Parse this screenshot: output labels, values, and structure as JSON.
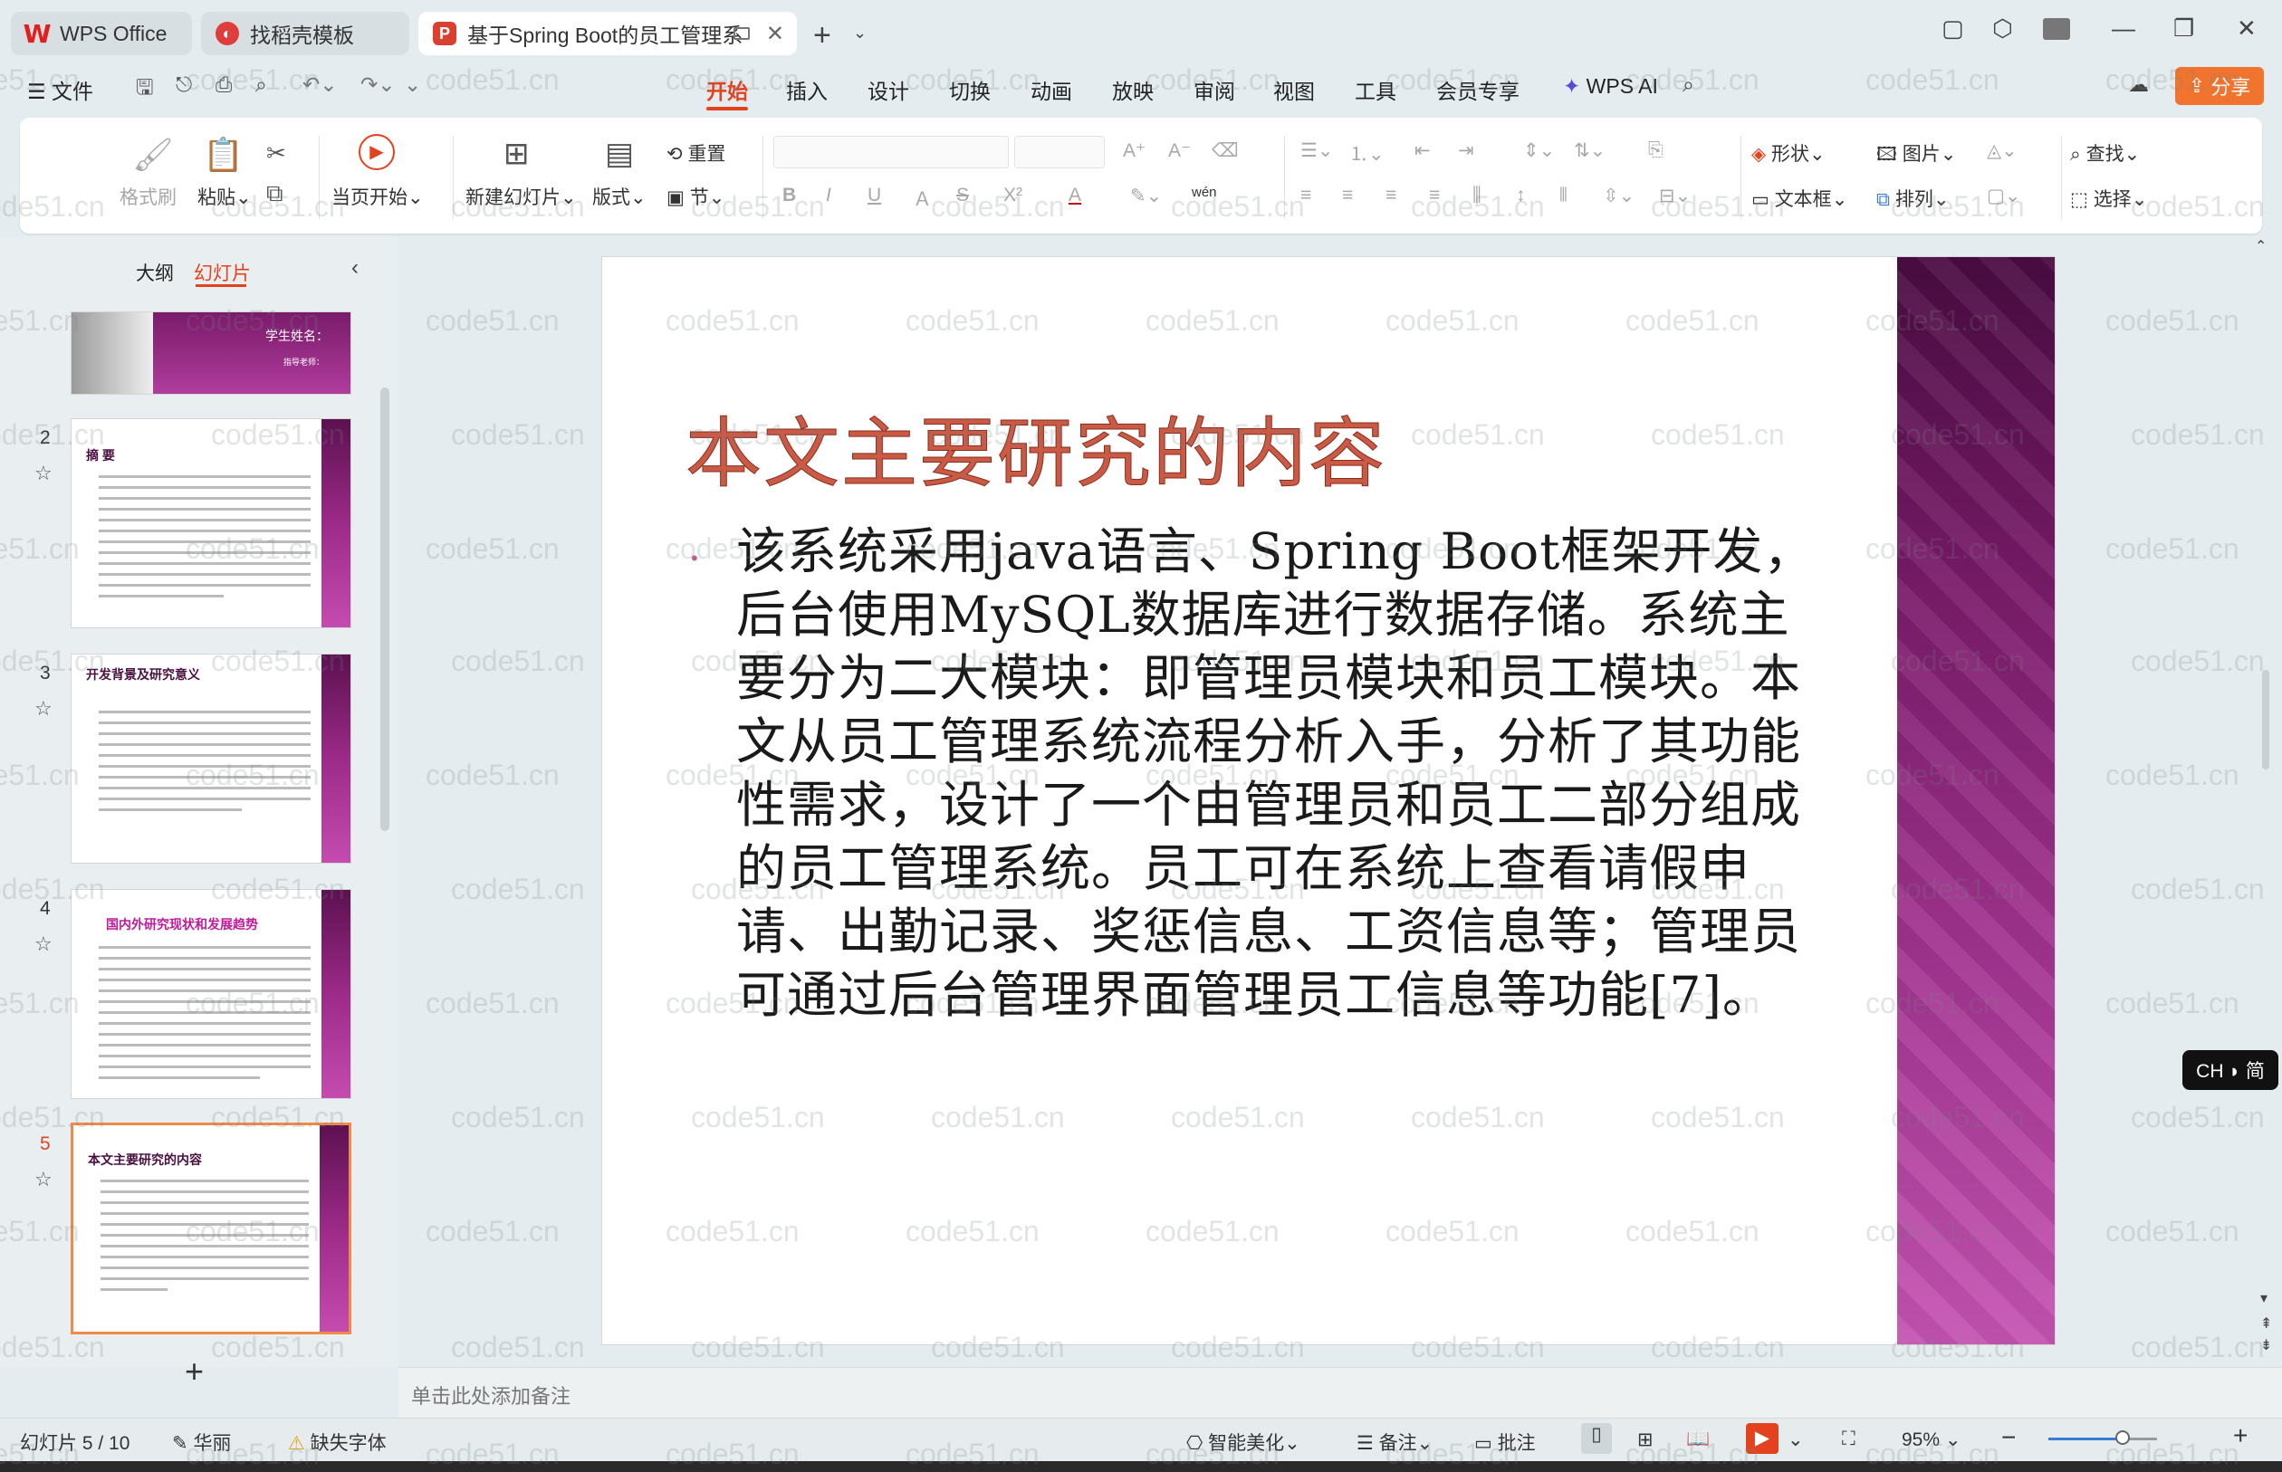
{
  "tabs": [
    {
      "label": "WPS Office"
    },
    {
      "label": "找稻壳模板"
    },
    {
      "label": "基于Spring Boot的员工管理系"
    }
  ],
  "menu": [
    "文件",
    "开始",
    "插入",
    "设计",
    "切换",
    "动画",
    "放映",
    "审阅",
    "视图",
    "工具",
    "会员专享",
    "WPS AI"
  ],
  "share_label": "分享",
  "ribbon": {
    "format_painter": "格式刷",
    "paste": "粘贴",
    "start_from_current": "当页开始",
    "new_slide": "新建幻灯片",
    "layout": "版式",
    "reset": "重置",
    "section": "节",
    "shape": "形状",
    "picture": "图片",
    "textbox": "文本框",
    "arrange": "排列",
    "find": "查找",
    "select": "选择",
    "bold": "B",
    "italic": "I",
    "underline": "U",
    "strike": "S",
    "superscript": "X²",
    "font_color": "A",
    "phonetic": "wén"
  },
  "left_panel": {
    "tab_outline": "大纲",
    "tab_slides": "幻灯片",
    "thumb1_name": "学生姓名：",
    "thumb1_sub": "指导老师：",
    "thumbs": [
      {
        "num": "2",
        "title": "摘  要"
      },
      {
        "num": "3",
        "title": "开发背景及研究意义"
      },
      {
        "num": "4",
        "title": "国内外研究现状和发展趋势"
      },
      {
        "num": "5",
        "title": "本文主要研究的内容"
      }
    ]
  },
  "slide": {
    "title": "本文主要研究的内容",
    "body": "该系统采用java语言、Spring Boot框架开发，后台使用MySQL数据库进行数据存储。系统主要分为二大模块：即管理员模块和员工模块。本文从员工管理系统流程分析入手，分析了其功能性需求，设计了一个由管理员和员工二部分组成的员工管理系统。员工可在系统上查看请假申请、出勤记录、奖惩信息、工资信息等；管理员可通过后台管理界面管理员工信息等功能[7]。"
  },
  "notes_placeholder": "单击此处添加备注",
  "status": {
    "slide_count": "幻灯片 5 / 10",
    "theme": "华丽",
    "missing_font": "缺失字体",
    "smart_beautify": "智能美化",
    "notes": "备注",
    "comment": "批注",
    "zoom": "95%"
  },
  "ime": "CH ◗ 简",
  "watermark": "code51.cn"
}
